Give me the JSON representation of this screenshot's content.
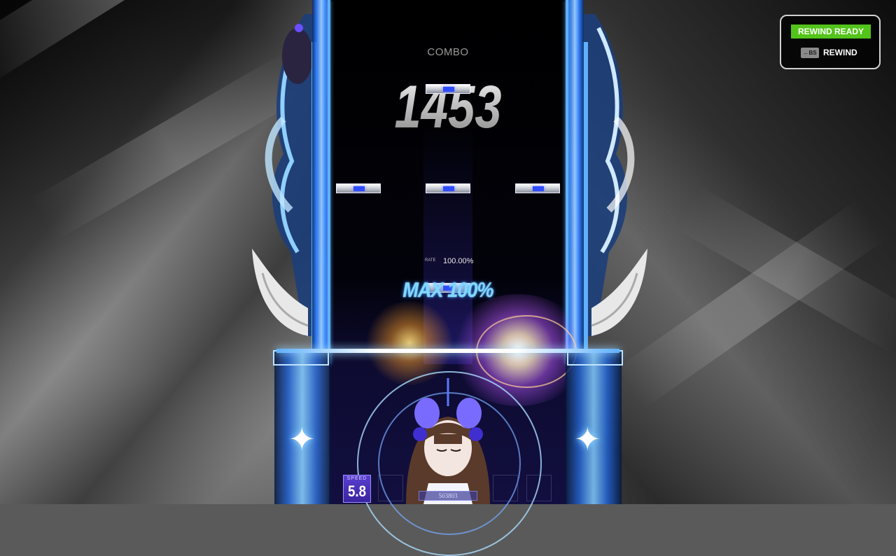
{
  "hud": {
    "combo_label": "COMBO",
    "combo_count": "1453",
    "rate_label": "RATE",
    "rate_value": "100.00%",
    "judgement_text": "MAX 100%",
    "speed_label": "SPEED",
    "speed_value": "5.8",
    "score_value": "503803"
  },
  "rewind": {
    "ready_label": "REWIND READY",
    "key_label": "←BS",
    "action_label": "REWIND",
    "ready_color": "#53c41a"
  },
  "theme": {
    "lane_accent": "#2f7fff",
    "note_core": "#2f4cff",
    "speed_box": "#5a3fd0"
  }
}
